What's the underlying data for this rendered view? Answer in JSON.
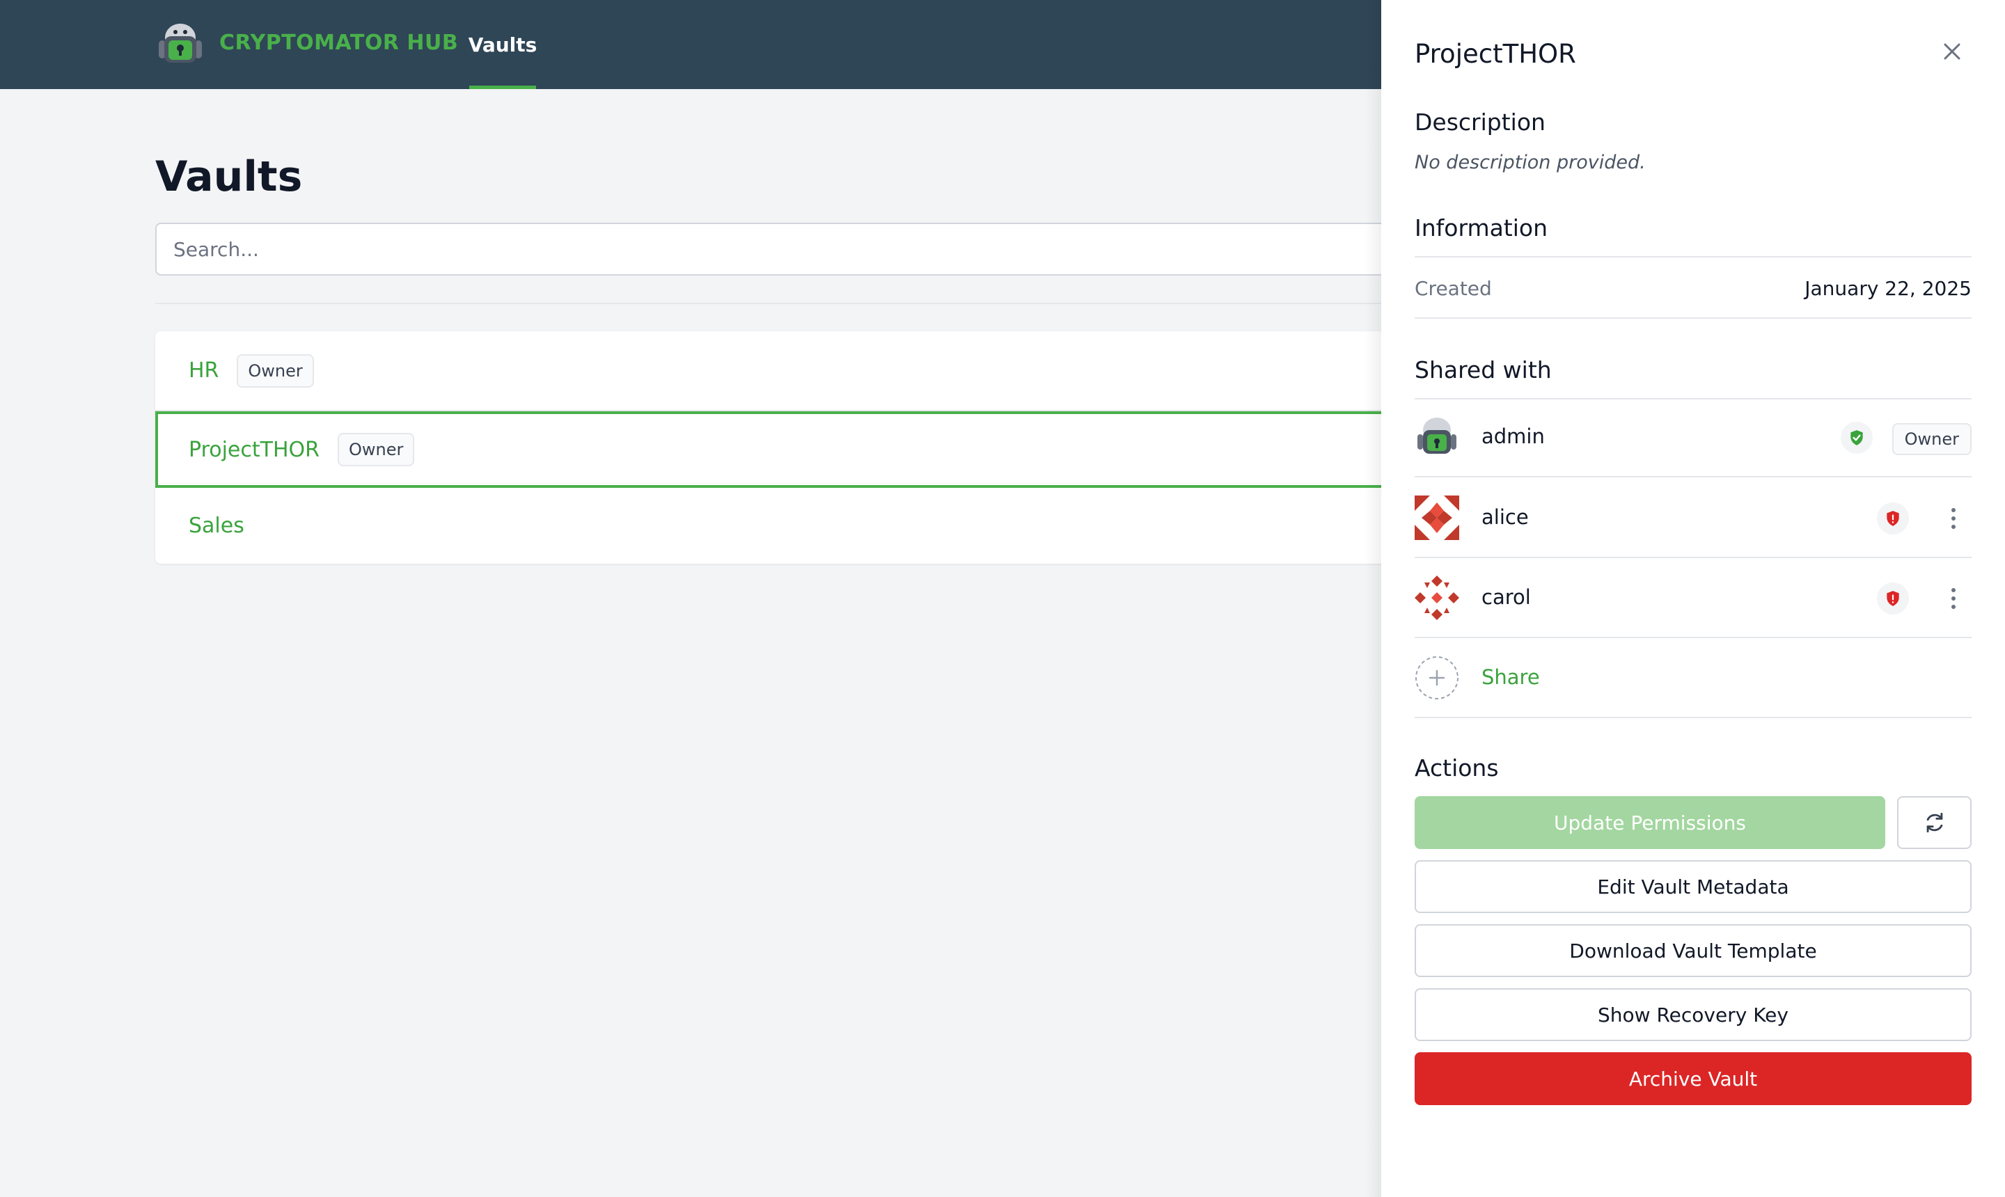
{
  "header": {
    "brand": "CRYPTOMATOR HUB",
    "nav_vaults": "Vaults",
    "accent": "#49b04a",
    "background": "#2f4656"
  },
  "main": {
    "title": "Vaults",
    "search_placeholder": "Search...",
    "vaults": [
      {
        "name": "HR",
        "role": "Owner"
      },
      {
        "name": "ProjectTHOR",
        "role": "Owner",
        "selected": true
      },
      {
        "name": "Sales",
        "role": ""
      }
    ]
  },
  "panel": {
    "title": "ProjectTHOR",
    "description_heading": "Description",
    "description_text": "No description provided.",
    "information_heading": "Information",
    "created_label": "Created",
    "created_value": "January 22, 2025",
    "shared_heading": "Shared with",
    "members": [
      {
        "name": "admin",
        "status": "verified",
        "role": "Owner"
      },
      {
        "name": "alice",
        "status": "unverified"
      },
      {
        "name": "carol",
        "status": "unverified"
      }
    ],
    "share_label": "Share",
    "actions_heading": "Actions",
    "update_permissions": "Update Permissions",
    "edit_metadata": "Edit Vault Metadata",
    "download_template": "Download Vault Template",
    "show_recovery_key": "Show Recovery Key",
    "archive_vault": "Archive Vault",
    "colors": {
      "danger": "#dc2626",
      "verified": "#3aa33c",
      "unverified": "#dc2626"
    }
  }
}
